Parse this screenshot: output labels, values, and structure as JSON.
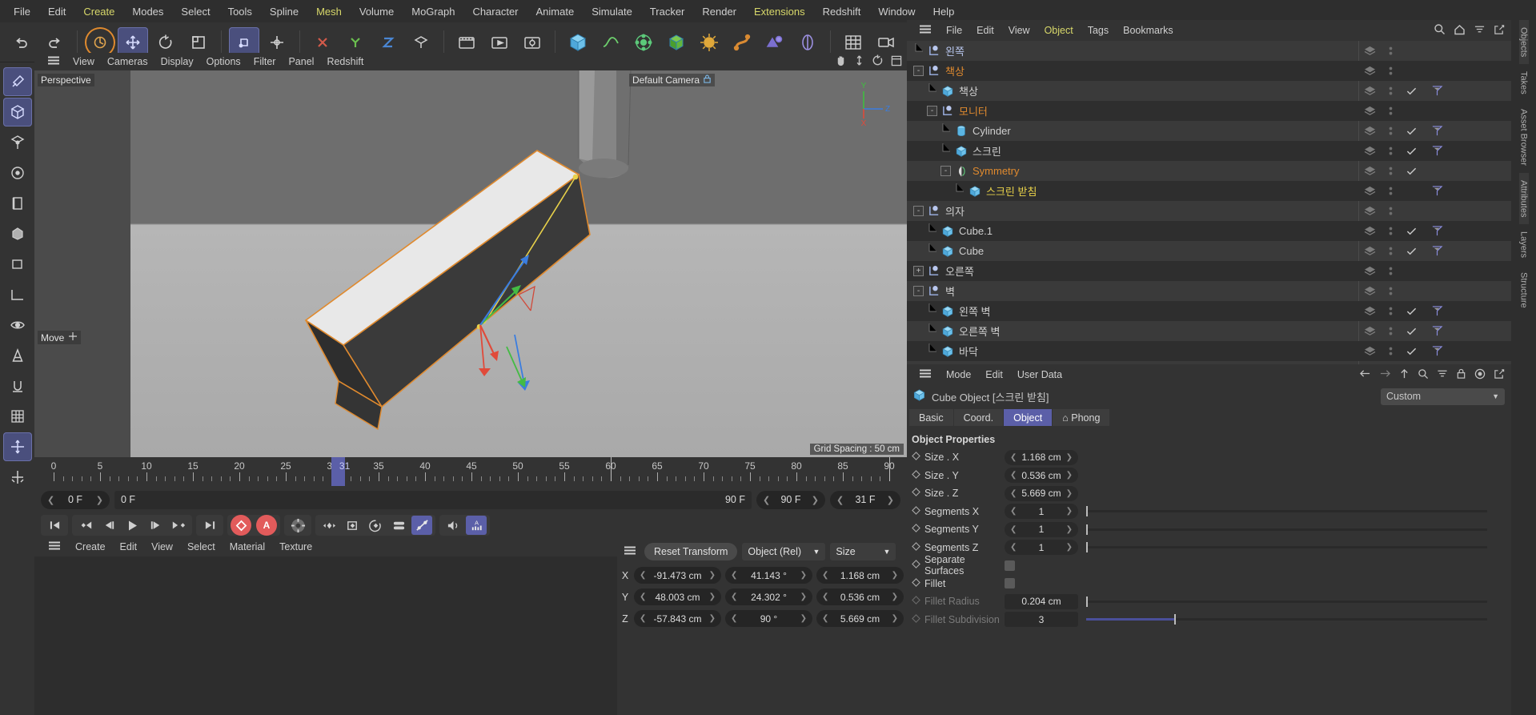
{
  "menubar": {
    "items": [
      {
        "label": "File",
        "hl": false
      },
      {
        "label": "Edit",
        "hl": false
      },
      {
        "label": "Create",
        "hl": true
      },
      {
        "label": "Modes",
        "hl": false
      },
      {
        "label": "Select",
        "hl": false
      },
      {
        "label": "Tools",
        "hl": false
      },
      {
        "label": "Spline",
        "hl": false
      },
      {
        "label": "Mesh",
        "hl": true
      },
      {
        "label": "Volume",
        "hl": false
      },
      {
        "label": "MoGraph",
        "hl": false
      },
      {
        "label": "Character",
        "hl": false
      },
      {
        "label": "Animate",
        "hl": false
      },
      {
        "label": "Simulate",
        "hl": false
      },
      {
        "label": "Tracker",
        "hl": false
      },
      {
        "label": "Render",
        "hl": false
      },
      {
        "label": "Extensions",
        "hl": true
      },
      {
        "label": "Redshift",
        "hl": false
      },
      {
        "label": "Window",
        "hl": false
      },
      {
        "label": "Help",
        "hl": false
      }
    ]
  },
  "toolbar": {
    "icons": [
      "undo-icon",
      "redo-icon",
      "live-selection-icon",
      "move-icon",
      "rotate-icon",
      "scale-icon",
      "world-object-axis-icon",
      "enable-axis-icon",
      "lock-x-icon",
      "lock-y-icon",
      "lock-z-icon",
      "workplane-icon",
      "render-view-icon",
      "render-region-icon",
      "render-settings-icon",
      "cube-primitive-icon",
      "spline-pen-icon",
      "mograph-cloner-icon",
      "subdivision-surface-icon",
      "simulate-icon",
      "deformer-icon",
      "field-icon",
      "material-node-icon",
      "layout-grid-icon",
      "camera-icon",
      "light-icon"
    ]
  },
  "lefttools": {
    "icons": [
      "brush-tool-icon",
      "model-mode-icon",
      "object-axis-mode-icon",
      "point-mode-icon",
      "edge-mode-icon",
      "polygon-mode-icon",
      "texture-axis-icon",
      "workplane-mode-icon",
      "viewport-solo-icon",
      "animation-mode-icon",
      "uv-mode-icon",
      "snap-icon",
      "grid-snap-icon",
      "axis-lock-icon",
      "modeling-axis-icon"
    ]
  },
  "viewport": {
    "menu": [
      "View",
      "Cameras",
      "Display",
      "Options",
      "Filter",
      "Panel",
      "Redshift"
    ],
    "menu_icons": [
      "hand-icon",
      "pan-z-icon",
      "rotate-view-icon",
      "maximize-view-icon"
    ],
    "label_topleft": "Perspective",
    "label_camera": "Default Camera",
    "label_tool": "Move",
    "grid_spacing": "Grid Spacing : 50 cm",
    "axis_labels": {
      "x": "X",
      "y": "Y",
      "z": "Z"
    },
    "colors": {
      "x": "#e04a3a",
      "y": "#53c14a",
      "z": "#3a7de0",
      "selection": "#e08a2e"
    }
  },
  "timeline": {
    "ticks": [
      0,
      5,
      10,
      15,
      20,
      25,
      30,
      35,
      40,
      45,
      50,
      55,
      60,
      65,
      70,
      75,
      80,
      85,
      90
    ],
    "current_label": "31",
    "current_frame": "31 F",
    "start_field": "0 F",
    "end_field": "90 F",
    "range_start": "0 F",
    "range_end": "90 F",
    "transport_icons": [
      "go-to-start-icon",
      "prev-keyframe-icon",
      "prev-frame-icon",
      "play-icon",
      "next-frame-icon",
      "next-keyframe-icon",
      "go-to-end-icon"
    ],
    "record_icons": [
      "record-keyframe-icon",
      "autokey-icon"
    ],
    "option_icons": [
      "keyframe-settings-icon",
      "position-key-icon",
      "scale-key-icon",
      "rotation-key-icon",
      "parameter-key-icon",
      "pla-key-icon",
      "sound-icon",
      "auto-key-icon"
    ]
  },
  "material_manager": {
    "menu": [
      "Create",
      "Edit",
      "View",
      "Select",
      "Material",
      "Texture"
    ]
  },
  "coordinates": {
    "reset_label": "Reset Transform",
    "mode": "Object (Rel)",
    "size_mode": "Size",
    "rows": [
      {
        "axis": "X",
        "position": "-91.473 cm",
        "rotation": "41.143 °",
        "size": "1.168 cm"
      },
      {
        "axis": "Y",
        "position": "48.003 cm",
        "rotation": "24.302 °",
        "size": "0.536 cm"
      },
      {
        "axis": "Z",
        "position": "-57.843 cm",
        "rotation": "90 °",
        "size": "5.669 cm"
      }
    ]
  },
  "object_manager": {
    "menu": [
      {
        "label": "File",
        "hl": false
      },
      {
        "label": "Edit",
        "hl": false
      },
      {
        "label": "View",
        "hl": false
      },
      {
        "label": "Object",
        "hl": true
      },
      {
        "label": "Tags",
        "hl": false
      },
      {
        "label": "Bookmarks",
        "hl": false
      }
    ],
    "icons": [
      "search-icon",
      "home-icon",
      "filter-icon",
      "open-external-icon"
    ],
    "items": [
      {
        "label": "왼쪽",
        "depth": 1,
        "icon": "null-object-icon",
        "expander": "",
        "color": "#b9c7ee",
        "dark": false,
        "layer": true,
        "dots": true,
        "check": false,
        "tag": false
      },
      {
        "label": "책상",
        "depth": 1,
        "icon": "null-object-icon",
        "expander": "-",
        "color": "#e08a2e",
        "dark": true,
        "layer": true,
        "dots": true,
        "check": false,
        "tag": false
      },
      {
        "label": "책상",
        "depth": 2,
        "icon": "cube-object-icon",
        "expander": "",
        "color": "#d0d0d0",
        "dark": false,
        "layer": true,
        "dots": true,
        "check": true,
        "tag": true
      },
      {
        "label": "모니터",
        "depth": 2,
        "icon": "null-object-icon",
        "expander": "-",
        "color": "#e08a2e",
        "dark": true,
        "layer": true,
        "dots": true,
        "check": false,
        "tag": false
      },
      {
        "label": "Cylinder",
        "depth": 3,
        "icon": "cylinder-object-icon",
        "expander": "",
        "color": "#d0d0d0",
        "dark": false,
        "layer": true,
        "dots": true,
        "check": true,
        "tag": true
      },
      {
        "label": "스크린",
        "depth": 3,
        "icon": "cube-object-icon",
        "expander": "",
        "color": "#d0d0d0",
        "dark": true,
        "layer": true,
        "dots": true,
        "check": true,
        "tag": true
      },
      {
        "label": "Symmetry",
        "depth": 3,
        "icon": "symmetry-object-icon",
        "expander": "-",
        "color": "#e08a2e",
        "dark": false,
        "layer": true,
        "dots": true,
        "check": true,
        "tag": false
      },
      {
        "label": "스크린 받침",
        "depth": 4,
        "icon": "cube-object-icon",
        "expander": "",
        "color": "#e8d14a",
        "dark": true,
        "layer": true,
        "dots": true,
        "check": false,
        "tag": true
      },
      {
        "label": "의자",
        "depth": 1,
        "icon": "null-object-icon",
        "expander": "-",
        "color": "#d0d0d0",
        "dark": false,
        "layer": true,
        "dots": true,
        "check": false,
        "tag": false
      },
      {
        "label": "Cube.1",
        "depth": 2,
        "icon": "cube-object-icon",
        "expander": "",
        "color": "#d0d0d0",
        "dark": true,
        "layer": true,
        "dots": true,
        "check": true,
        "tag": true
      },
      {
        "label": "Cube",
        "depth": 2,
        "icon": "cube-object-icon",
        "expander": "",
        "color": "#d0d0d0",
        "dark": false,
        "layer": true,
        "dots": true,
        "check": true,
        "tag": true
      },
      {
        "label": "오른쪽",
        "depth": 1,
        "icon": "null-object-icon",
        "expander": "+",
        "color": "#d0d0d0",
        "dark": true,
        "layer": true,
        "dots": true,
        "check": false,
        "tag": false
      },
      {
        "label": "벽",
        "depth": 1,
        "icon": "null-object-icon",
        "expander": "-",
        "color": "#d0d0d0",
        "dark": false,
        "layer": true,
        "dots": true,
        "check": false,
        "tag": false
      },
      {
        "label": "왼쪽 벽",
        "depth": 2,
        "icon": "cube-object-icon",
        "expander": "",
        "color": "#d0d0d0",
        "dark": true,
        "layer": true,
        "dots": true,
        "check": true,
        "tag": true
      },
      {
        "label": "오른쪽 벽",
        "depth": 2,
        "icon": "cube-object-icon",
        "expander": "",
        "color": "#d0d0d0",
        "dark": false,
        "layer": true,
        "dots": true,
        "check": true,
        "tag": true
      },
      {
        "label": "바닥",
        "depth": 2,
        "icon": "cube-object-icon",
        "expander": "",
        "color": "#d0d0d0",
        "dark": true,
        "layer": true,
        "dots": true,
        "check": true,
        "tag": true
      }
    ]
  },
  "attributes": {
    "menu": [
      "Mode",
      "Edit",
      "User Data"
    ],
    "icons": [
      "back-arrow-icon",
      "forward-arrow-icon",
      "up-arrow-icon",
      "search-icon",
      "filter-icon",
      "lock-icon",
      "target-icon",
      "open-external-icon"
    ],
    "title": "Cube Object [스크린 받침]",
    "title_icon": "cube-object-icon",
    "preset": "Custom",
    "tabs": [
      {
        "label": "Basic",
        "sel": false
      },
      {
        "label": "Coord.",
        "sel": false
      },
      {
        "label": "Object",
        "sel": true
      },
      {
        "label": "⌂ Phong",
        "sel": false
      }
    ],
    "section_title": "Object Properties",
    "properties": [
      {
        "label": "Size . X",
        "value": "1.168 cm",
        "type": "stepper",
        "dim": false
      },
      {
        "label": "Size . Y",
        "value": "0.536 cm",
        "type": "stepper",
        "dim": false
      },
      {
        "label": "Size . Z",
        "value": "5.669 cm",
        "type": "stepper",
        "dim": false
      },
      {
        "label": "Segments X",
        "value": "1",
        "type": "stepper-slider",
        "dim": false,
        "fill": 0
      },
      {
        "label": "Segments Y",
        "value": "1",
        "type": "stepper-slider",
        "dim": false,
        "fill": 0
      },
      {
        "label": "Segments Z",
        "value": "1",
        "type": "stepper-slider",
        "dim": false,
        "fill": 0
      },
      {
        "label": "Separate Surfaces",
        "value": "",
        "type": "checkbox",
        "dim": false
      },
      {
        "label": "Fillet",
        "value": "",
        "type": "checkbox",
        "dim": false
      },
      {
        "label": "Fillet Radius",
        "value": "0.204 cm",
        "type": "plain-slider",
        "dim": true,
        "fill": 0
      },
      {
        "label": "Fillet Subdivision",
        "value": "3",
        "type": "plain-slider",
        "dim": true,
        "fill": 22
      }
    ]
  },
  "right_dock": {
    "labels": [
      "Objects",
      "Takes",
      "Asset Browser",
      "Attributes",
      "Layers",
      "Structure"
    ]
  }
}
